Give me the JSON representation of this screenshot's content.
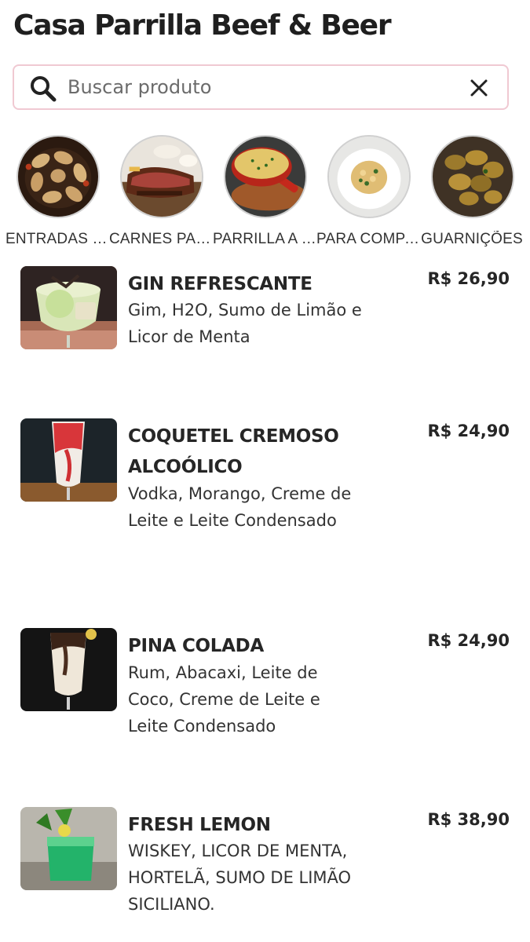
{
  "header": {
    "title": "Casa Parrilla Beef & Beer"
  },
  "search": {
    "placeholder": "Buscar produto",
    "value": ""
  },
  "categories": [
    {
      "label": "ENTRADAS E PETISCOS",
      "icon": "fried-appetizers-photo"
    },
    {
      "label": "CARNES PARRILLA",
      "icon": "grilled-steak-photo"
    },
    {
      "label": "PARRILLA A DOIS",
      "icon": "cheese-pan-photo"
    },
    {
      "label": "PARA COMPARTILHAR",
      "icon": "pasta-plate-photo"
    },
    {
      "label": "GUARNIÇÕES",
      "icon": "fried-potatoes-photo"
    }
  ],
  "products": [
    {
      "name": "GIN REFRESCANTE",
      "description": "Gim, H2O, Sumo de Limão e Licor de Menta",
      "price": "R$ 26,90",
      "icon": "gin-glass-photo"
    },
    {
      "name": "COQUETEL CREMOSO ALCOÓLICO",
      "description": "Vodka, Morango, Creme de Leite e Leite Condensado",
      "price": "R$ 24,90",
      "icon": "strawberry-cocktail-photo"
    },
    {
      "name": "PINA COLADA",
      "description": "Rum, Abacaxi, Leite de Coco, Creme de Leite e Leite Condensado",
      "price": "R$ 24,90",
      "icon": "pina-colada-photo"
    },
    {
      "name": "FRESH LEMON",
      "description": "WISKEY, LICOR DE MENTA, HORTELÃ, SUMO DE LIMÃO SICILIANO.",
      "price": "R$ 38,90",
      "icon": "green-drink-photo"
    }
  ],
  "colors": {
    "search_border": "#f0c9d2",
    "text": "#262626"
  }
}
